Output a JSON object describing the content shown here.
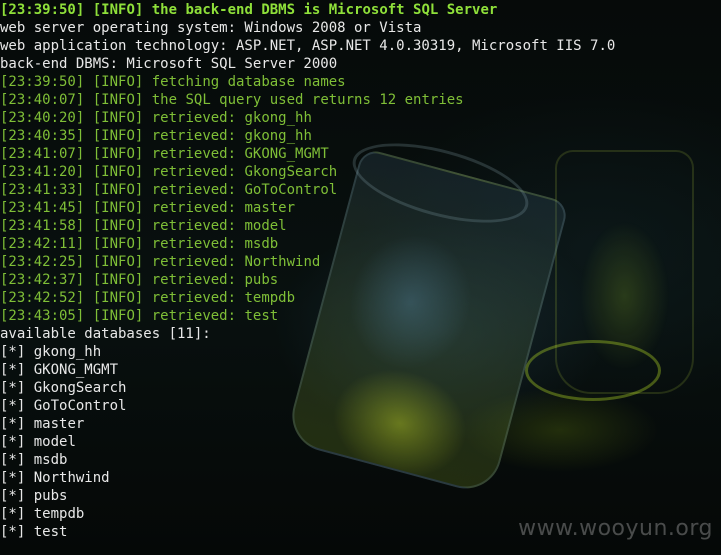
{
  "header_line": {
    "time": "[23:39:50]",
    "level": "[INFO]",
    "message": "the back-end DBMS is Microsoft SQL Server"
  },
  "info_lines": [
    "web server operating system: Windows 2008 or Vista",
    "web application technology: ASP.NET, ASP.NET 4.0.30319, Microsoft IIS 7.0",
    "back-end DBMS: Microsoft SQL Server 2000"
  ],
  "log_lines": [
    {
      "time": "[23:39:50]",
      "level": "[INFO]",
      "message": "fetching database names"
    },
    {
      "time": "[23:40:07]",
      "level": "[INFO]",
      "message": "the SQL query used returns 12 entries"
    },
    {
      "time": "[23:40:20]",
      "level": "[INFO]",
      "message": "retrieved: gkong_hh"
    },
    {
      "time": "[23:40:35]",
      "level": "[INFO]",
      "message": "retrieved: gkong_hh"
    },
    {
      "time": "[23:41:07]",
      "level": "[INFO]",
      "message": "retrieved: GKONG_MGMT"
    },
    {
      "time": "[23:41:20]",
      "level": "[INFO]",
      "message": "retrieved: GkongSearch"
    },
    {
      "time": "[23:41:33]",
      "level": "[INFO]",
      "message": "retrieved: GoToControl"
    },
    {
      "time": "[23:41:45]",
      "level": "[INFO]",
      "message": "retrieved: master"
    },
    {
      "time": "[23:41:58]",
      "level": "[INFO]",
      "message": "retrieved: model"
    },
    {
      "time": "[23:42:11]",
      "level": "[INFO]",
      "message": "retrieved: msdb"
    },
    {
      "time": "[23:42:25]",
      "level": "[INFO]",
      "message": "retrieved: Northwind"
    },
    {
      "time": "[23:42:37]",
      "level": "[INFO]",
      "message": "retrieved: pubs"
    },
    {
      "time": "[23:42:52]",
      "level": "[INFO]",
      "message": "retrieved: tempdb"
    },
    {
      "time": "[23:43:05]",
      "level": "[INFO]",
      "message": "retrieved: test"
    }
  ],
  "databases_header": "available databases [11]:",
  "database_bullet": "[*]",
  "databases": [
    "gkong_hh",
    "GKONG_MGMT",
    "GkongSearch",
    "GoToControl",
    "master",
    "model",
    "msdb",
    "Northwind",
    "pubs",
    "tempdb",
    "test"
  ],
  "watermark": "www.wooyun.org",
  "colors": {
    "log_green": "#7fbf37",
    "header_green": "#8fe03a",
    "text_white": "#e8e8e8",
    "background": "#050807"
  }
}
